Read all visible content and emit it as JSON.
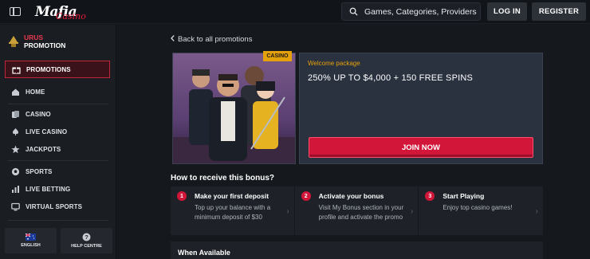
{
  "header": {
    "logo_main": "Mafia",
    "logo_sub": "Casino",
    "search_placeholder": "Games, Categories, Providers",
    "login_label": "LOG IN",
    "register_label": "REGISTER"
  },
  "sidebar": {
    "promo_line1": "URUS",
    "promo_line2": "PROMOTION",
    "items": [
      {
        "label": "PROMOTIONS",
        "icon": "gift-icon",
        "active": true
      },
      {
        "label": "HOME",
        "icon": "home-icon"
      },
      {
        "label": "CASINO",
        "icon": "cards-icon"
      },
      {
        "label": "LIVE CASINO",
        "icon": "spade-icon"
      },
      {
        "label": "JACKPOTS",
        "icon": "star-icon"
      },
      {
        "label": "SPORTS",
        "icon": "football-icon"
      },
      {
        "label": "LIVE BETTING",
        "icon": "chart-icon"
      },
      {
        "label": "VIRTUAL SPORTS",
        "icon": "monitor-icon"
      }
    ],
    "footer": {
      "language_label": "ENGLISH",
      "help_label": "HELP CENTRE"
    }
  },
  "main": {
    "back_label": "Back to all promotions",
    "badge": "CASINO",
    "offer_kicker": "Welcome package",
    "offer_title": "250% UP TO $4,000 + 150 FREE SPINS",
    "join_label": "JOIN NOW",
    "how_title": "How to receive this bonus?",
    "steps": [
      {
        "num": "1",
        "title": "Make your first deposit",
        "desc": "Top up your balance with a minimum deposit of $30"
      },
      {
        "num": "2",
        "title": "Activate your bonus",
        "desc": "Visit My Bonus section in your profile and activate the promo"
      },
      {
        "num": "3",
        "title": "Start Playing",
        "desc": "Enjoy top casino games!"
      }
    ],
    "when_available": "When Available"
  },
  "colors": {
    "accent": "#d1163a",
    "gold": "#e5a10b",
    "bg": "#15181d",
    "sidebar": "#1a1d22"
  }
}
